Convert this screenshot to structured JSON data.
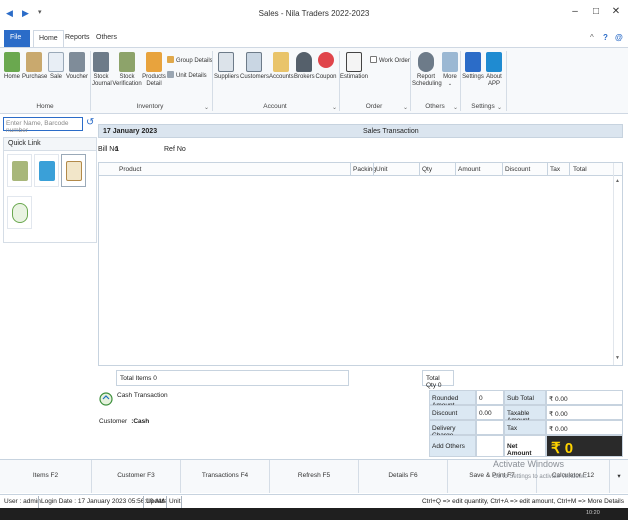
{
  "window": {
    "title": "Sales - Nila Traders 2022-2023",
    "minimize": "–",
    "restore": "□",
    "close": "✕"
  },
  "ribbon_tabs": {
    "file": "File",
    "home": "Home",
    "reports": "Reports",
    "others": "Others",
    "collapse": "^",
    "help": "?",
    "about": "@"
  },
  "ribbon": {
    "home_group": {
      "label": "Home",
      "items": [
        "Home",
        "Purchase",
        "Sale",
        "Voucher"
      ]
    },
    "inventory_group": {
      "label": "Inventory",
      "items": [
        "Stock\nJournal",
        "Stock\nVerification",
        "Products\nDetail"
      ],
      "small": [
        "Group Details",
        "Unit Details"
      ]
    },
    "account_group": {
      "label": "Account",
      "items": [
        "Suppliers",
        "Customers",
        "Accounts",
        "Brokers",
        "Coupon"
      ]
    },
    "order_group": {
      "label": "Order",
      "items": [
        "Estimation"
      ],
      "small": [
        "Work Order"
      ]
    },
    "others_group": {
      "label": "Others",
      "items": [
        "Report\nScheduling",
        "More"
      ]
    },
    "settings_group": {
      "label": "Settings",
      "items": [
        "Settings",
        "About\nAPP"
      ]
    }
  },
  "search": {
    "placeholder": "Enter Name, Barcode number"
  },
  "quick_link": {
    "title": "Quick Link"
  },
  "transaction": {
    "date": "17 January 2023",
    "title": "Sales Transaction",
    "bill_no_label": "Bill No",
    "bill_no": "1",
    "ref_no_label": "Ref No",
    "columns": [
      "Product",
      "Packing",
      "Unit",
      "Qty",
      "Amount",
      "Discount",
      "Tax",
      "Total"
    ]
  },
  "totals": {
    "total_items": "Total Items 0",
    "total_qty": "Total Qty 0",
    "cash_transaction": "Cash Transaction",
    "customer_label": "Customer",
    "customer_value": ":Cash"
  },
  "summary": {
    "rounded_amount_label": "Rounded Amount",
    "rounded_amount": "0",
    "discount_label": "Discount",
    "discount": "0.00",
    "delivery_charge_label": "Delivery Charge",
    "add_others_label": "Add Others",
    "sub_total_label": "Sub Total",
    "sub_total": "₹ 0.00",
    "taxable_amount_label": "Taxable Amount",
    "taxable_amount": "₹ 0.00",
    "tax_label": "Tax",
    "tax": "₹ 0.00",
    "net_amount_label": "Net Amount",
    "net_amount": "₹ 0"
  },
  "bottom_buttons": [
    "Items F2",
    "Customer F3",
    "Transactions F4",
    "Refresh F5",
    "Details F6",
    "Save & Print F7",
    "Calculator F12"
  ],
  "watermark": {
    "title": "Activate Windows",
    "sub": "Go to Settings to activate Windows."
  },
  "status": {
    "user": "User : admin",
    "login_date": "Login Date : 17 January 2023 05:56:10 AM",
    "update": "Update",
    "unit": "Unit",
    "hint": "Ctrl+Q => edit quantity, Ctrl+A => edit amount, Ctrl+M => More Details"
  },
  "taskbar": {
    "time": "10:20"
  },
  "colors": {
    "accent": "#2b6cc8",
    "net_bg": "#2a2a2a",
    "net_fg": "#ffd400",
    "label_bg": "#dbe8f3"
  }
}
